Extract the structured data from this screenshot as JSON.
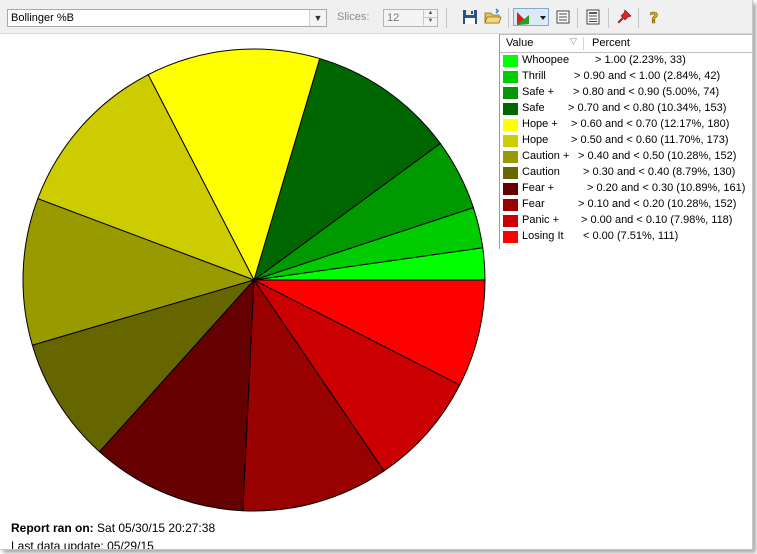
{
  "toolbar": {
    "indicator_value": "Bollinger %B",
    "slices_label": "Slices:",
    "slices_value": "12"
  },
  "legend": {
    "header_value": "Value",
    "header_percent": "Percent"
  },
  "report": {
    "label": "Report ran on:",
    "value": "Sat 05/30/15 20:27:38",
    "second_line": "Last data update: 05/29/15"
  },
  "colors": {
    "Whoopee": "#00ff00",
    "Thrill": "#00cc00",
    "Safe +": "#009900",
    "Safe": "#006600",
    "Hope +": "#ffff00",
    "Hope": "#cccc00",
    "Caution +": "#999900",
    "Caution": "#666600",
    "Fear +": "#660000",
    "Fear": "#990000",
    "Panic +": "#cc0000",
    "Losing It": "#ff0000"
  },
  "chart_data": {
    "type": "pie",
    "start": "3 o'clock",
    "direction": "counter-clockwise",
    "slices": [
      {
        "name": "Whoopee",
        "range": "> 1.00 (2.23%, 33)",
        "percent": 2.23,
        "count": 33
      },
      {
        "name": "Thrill",
        "range": "> 0.90 and < 1.00 (2.84%, 42)",
        "percent": 2.84,
        "count": 42
      },
      {
        "name": "Safe +",
        "range": "> 0.80 and < 0.90 (5.00%, 74)",
        "percent": 5.0,
        "count": 74
      },
      {
        "name": "Safe",
        "range": "> 0.70 and < 0.80 (10.34%, 153)",
        "percent": 10.34,
        "count": 153
      },
      {
        "name": "Hope +",
        "range": "> 0.60 and < 0.70 (12.17%, 180)",
        "percent": 12.17,
        "count": 180
      },
      {
        "name": "Hope",
        "range": "> 0.50 and < 0.60 (11.70%, 173)",
        "percent": 11.7,
        "count": 173
      },
      {
        "name": "Caution +",
        "range": "> 0.40 and < 0.50 (10.28%, 152)",
        "percent": 10.28,
        "count": 152
      },
      {
        "name": "Caution",
        "range": "> 0.30 and < 0.40 (8.79%, 130)",
        "percent": 8.79,
        "count": 130
      },
      {
        "name": "Fear +",
        "range": "> 0.20 and < 0.30 (10.89%, 161)",
        "percent": 10.89,
        "count": 161
      },
      {
        "name": "Fear",
        "range": "> 0.10 and < 0.20 (10.28%, 152)",
        "percent": 10.28,
        "count": 152
      },
      {
        "name": "Panic +",
        "range": "> 0.00 and < 0.10 (7.98%, 118)",
        "percent": 7.98,
        "count": 118
      },
      {
        "name": "Losing It",
        "range": "< 0.00 (7.51%, 111)",
        "percent": 7.51,
        "count": 111
      }
    ]
  }
}
